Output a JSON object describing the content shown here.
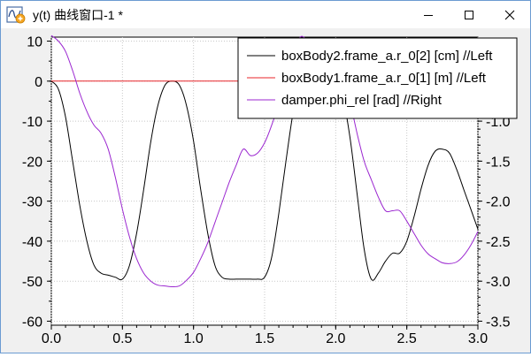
{
  "window": {
    "title": "y(t) 曲线窗口-1 *",
    "icons": {
      "app": "plot-window-icon",
      "minimize": "minimize-icon",
      "maximize": "maximize-icon",
      "close": "close-icon"
    }
  },
  "chart_data": {
    "type": "line",
    "title": "",
    "xlabel": "",
    "ylabel_left": "",
    "ylabel_right": "",
    "xlim": [
      0,
      3
    ],
    "ylim_left": [
      -61,
      11
    ],
    "ylim_right": [
      -3.55,
      0.05
    ],
    "x_ticks": [
      "0.0",
      "0.5",
      "1.0",
      "1.5",
      "2.0",
      "2.5",
      "3.0"
    ],
    "y_left_ticks": [
      "10",
      "0",
      "-10",
      "-20",
      "-30",
      "-40",
      "-50",
      "-60"
    ],
    "y_right_ticks": [
      "-1.0",
      "-1.5",
      "-2.0",
      "-2.5",
      "-3.0",
      "-3.5"
    ],
    "grid": true,
    "legend_position": "top-right",
    "series": [
      {
        "name": "boxBody2.frame_a.r_0[2] [cm] //Left",
        "color": "#000000",
        "axis": "left",
        "x": [
          0.0,
          0.05,
          0.1,
          0.15,
          0.2,
          0.25,
          0.3,
          0.35,
          0.4,
          0.45,
          0.5,
          0.55,
          0.6,
          0.65,
          0.7,
          0.75,
          0.8,
          0.85,
          0.9,
          0.95,
          1.0,
          1.05,
          1.1,
          1.15,
          1.2,
          1.25,
          1.3,
          1.35,
          1.4,
          1.45,
          1.5,
          1.55,
          1.6,
          1.65,
          1.7,
          1.75,
          1.8,
          1.85,
          1.9,
          1.95,
          2.0,
          2.05,
          2.1,
          2.15,
          2.2,
          2.25,
          2.3,
          2.35,
          2.4,
          2.45,
          2.5,
          2.55,
          2.6,
          2.65,
          2.7,
          2.75,
          2.8,
          2.85,
          2.9,
          2.95,
          3.0
        ],
        "y": [
          0,
          -2,
          -9,
          -20,
          -31,
          -40,
          -46,
          -48,
          -48.5,
          -49,
          -49.5,
          -46,
          -38,
          -27,
          -15,
          -6,
          -1,
          0,
          -1,
          -6,
          -15,
          -27,
          -38,
          -46,
          -49,
          -49.5,
          -49.5,
          -49.5,
          -49.5,
          -49.5,
          -49,
          -44,
          -33,
          -20,
          -8,
          -1,
          0,
          -1,
          -3,
          -2,
          -1,
          -4,
          -14,
          -28,
          -42,
          -49.5,
          -48,
          -45,
          -43,
          -43,
          -40,
          -34,
          -27,
          -21,
          -17.5,
          -17,
          -18,
          -22,
          -27,
          -32,
          -37
        ]
      },
      {
        "name": "boxBody1.frame_a.r_0[1] [m] //Left",
        "color": "#e8262a",
        "axis": "left",
        "x": [
          0.0,
          3.0
        ],
        "y": [
          0,
          0
        ]
      },
      {
        "name": "damper.phi_rel [rad] //Right",
        "color": "#9b27d0",
        "axis": "right",
        "x": [
          0.0,
          0.05,
          0.1,
          0.15,
          0.2,
          0.25,
          0.3,
          0.35,
          0.4,
          0.45,
          0.5,
          0.55,
          0.6,
          0.65,
          0.7,
          0.75,
          0.8,
          0.85,
          0.9,
          0.95,
          1.0,
          1.05,
          1.1,
          1.15,
          1.2,
          1.25,
          1.3,
          1.35,
          1.4,
          1.45,
          1.5,
          1.55,
          1.6,
          1.65,
          1.7,
          1.75,
          1.8,
          1.85,
          1.9,
          1.95,
          2.0,
          2.05,
          2.1,
          2.15,
          2.2,
          2.25,
          2.3,
          2.35,
          2.4,
          2.45,
          2.5,
          2.55,
          2.6,
          2.65,
          2.7,
          2.75,
          2.8,
          2.85,
          2.9,
          2.95,
          3.0
        ],
        "y": [
          0.07,
          0.0,
          -0.13,
          -0.37,
          -0.65,
          -0.88,
          -1.05,
          -1.15,
          -1.35,
          -1.7,
          -2.1,
          -2.45,
          -2.72,
          -2.9,
          -3.0,
          -3.05,
          -3.06,
          -3.07,
          -3.06,
          -2.99,
          -2.89,
          -2.72,
          -2.52,
          -2.27,
          -2.02,
          -1.77,
          -1.55,
          -1.35,
          -1.43,
          -1.4,
          -1.27,
          -1.05,
          -0.78,
          -0.46,
          -0.17,
          0.05,
          0.02,
          0.0,
          0.02,
          0.0,
          -0.1,
          -0.36,
          -0.75,
          -1.15,
          -1.5,
          -1.73,
          -1.95,
          -2.12,
          -2.12,
          -2.12,
          -2.25,
          -2.4,
          -2.55,
          -2.66,
          -2.72,
          -2.77,
          -2.78,
          -2.76,
          -2.68,
          -2.55,
          -2.38
        ]
      }
    ]
  }
}
